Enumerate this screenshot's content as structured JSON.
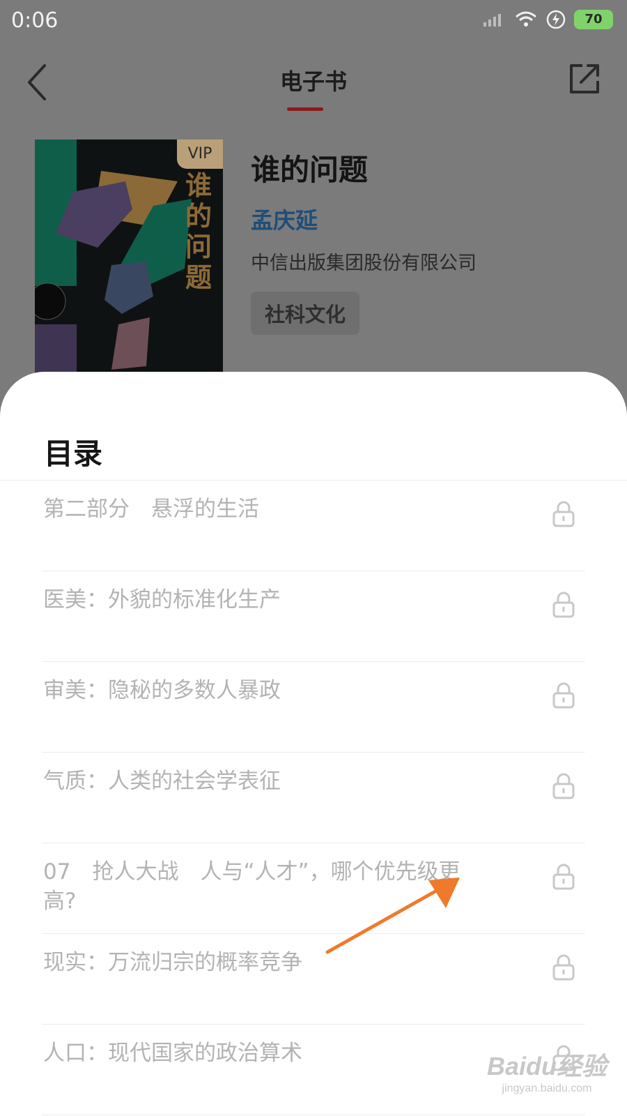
{
  "status_bar": {
    "time": "0:06",
    "battery": "70"
  },
  "header": {
    "title": "电子书"
  },
  "book": {
    "title": "谁的问题",
    "author": "孟庆延",
    "publisher": "中信出版集团股份有限公司",
    "category": "社科文化",
    "cover": {
      "badge": "VIP",
      "title": "谁的问题"
    }
  },
  "toc": {
    "title": "目录",
    "items": [
      {
        "label": "第二部分　悬浮的生活",
        "locked": true
      },
      {
        "label": "医美：外貌的标准化生产",
        "locked": true
      },
      {
        "label": "审美：隐秘的多数人暴政",
        "locked": true
      },
      {
        "label": "气质：人类的社会学表征",
        "locked": true
      },
      {
        "label": "07　抢人大战　人与“人才”，哪个优先级更高?",
        "locked": true
      },
      {
        "label": "现实：万流归宗的概率竞争",
        "locked": true
      },
      {
        "label": "人口：现代国家的政治算术",
        "locked": true
      }
    ]
  },
  "watermark": {
    "main": "Baidu经验",
    "sub": "jingyan.baidu.com"
  },
  "colors": {
    "accent_underline": "#d0262b",
    "author_link": "#3b95d6",
    "arrow": "#f07a2c"
  }
}
